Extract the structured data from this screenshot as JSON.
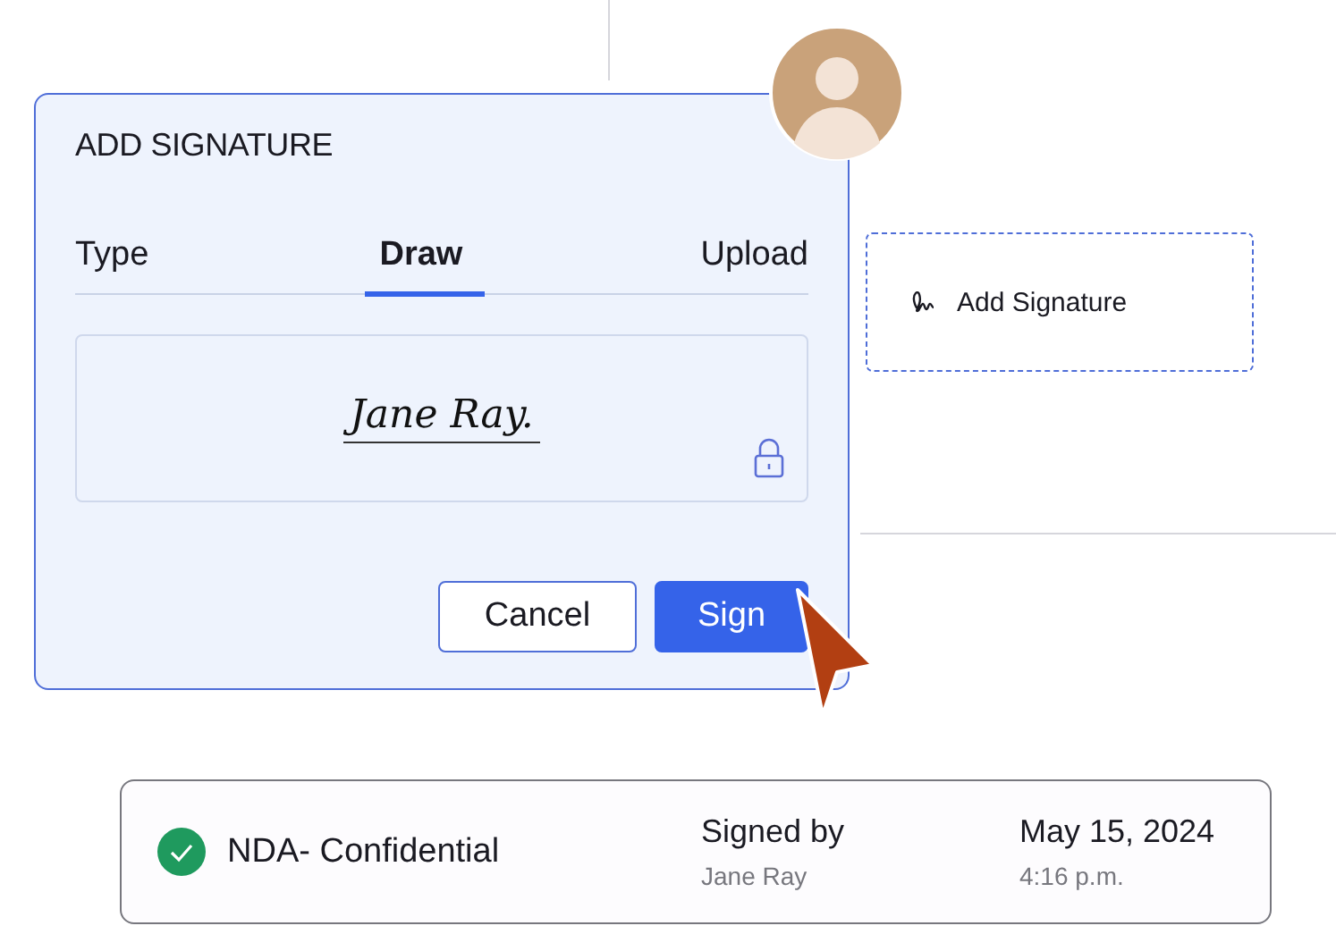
{
  "dialog": {
    "title": "ADD SIGNATURE",
    "tabs": [
      {
        "label": "Type",
        "selected": false
      },
      {
        "label": "Draw",
        "selected": true
      },
      {
        "label": "Upload",
        "selected": false
      }
    ],
    "signature": "Jane Ray.",
    "buttons": [
      {
        "label": "Cancel",
        "kind": "secondary"
      },
      {
        "label": "Sign",
        "kind": "primary"
      }
    ]
  },
  "signature_field": {
    "label": "Add Signature"
  },
  "document": {
    "name": "NDA- Confidential",
    "signed": true,
    "signed_label": "Signed by",
    "signer": "Jane Ray",
    "date": "May 15, 2024",
    "time": "4:16 p.m."
  }
}
